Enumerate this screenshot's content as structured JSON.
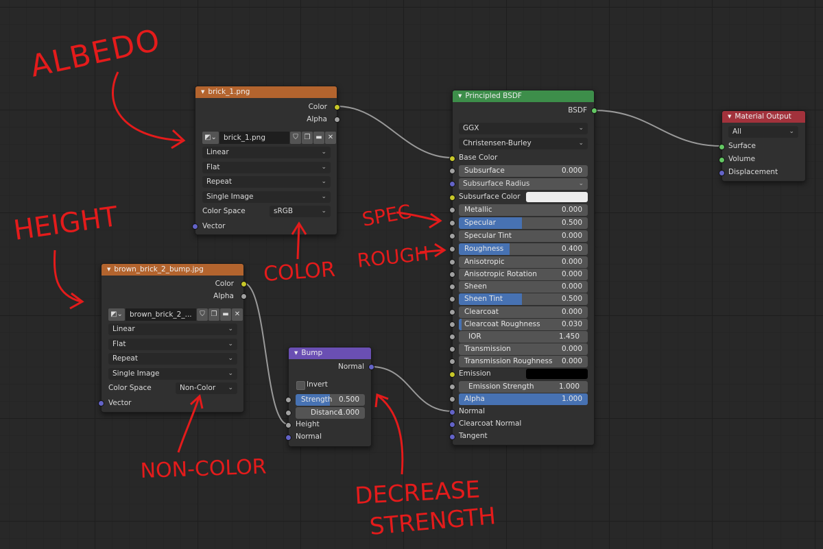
{
  "image_node_1": {
    "title": "brick_1.png",
    "outputs": [
      "Color",
      "Alpha"
    ],
    "image_name": "brick_1.png",
    "interpolation": "Linear",
    "projection": "Flat",
    "extension": "Repeat",
    "source": "Single Image",
    "color_space_label": "Color Space",
    "color_space": "sRGB",
    "input": "Vector"
  },
  "image_node_2": {
    "title": "brown_brick_2_bump.jpg",
    "outputs": [
      "Color",
      "Alpha"
    ],
    "image_name": "brown_brick_2_...",
    "interpolation": "Linear",
    "projection": "Flat",
    "extension": "Repeat",
    "source": "Single Image",
    "color_space_label": "Color Space",
    "color_space": "Non-Color",
    "input": "Vector"
  },
  "bump_node": {
    "title": "Bump",
    "output": "Normal",
    "invert_label": "Invert",
    "strength_label": "Strength",
    "strength_value": "0.500",
    "distance_label": "Distance",
    "distance_value": "1.000",
    "inputs": [
      "Height",
      "Normal"
    ]
  },
  "bsdf_node": {
    "title": "Principled BSDF",
    "output": "BSDF",
    "distribution": "GGX",
    "subsurface_method": "Christensen-Burley",
    "base_color_label": "Base Color",
    "subsurface_label": "Subsurface",
    "subsurface_value": "0.000",
    "subsurface_radius_label": "Subsurface Radius",
    "subsurface_color_label": "Subsurface Color",
    "metallic_label": "Metallic",
    "metallic_value": "0.000",
    "specular_label": "Specular",
    "specular_value": "0.500",
    "specular_tint_label": "Specular Tint",
    "specular_tint_value": "0.000",
    "roughness_label": "Roughness",
    "roughness_value": "0.400",
    "anisotropic_label": "Anisotropic",
    "anisotropic_value": "0.000",
    "anisotropic_rotation_label": "Anisotropic Rotation",
    "anisotropic_rotation_value": "0.000",
    "sheen_label": "Sheen",
    "sheen_value": "0.000",
    "sheen_tint_label": "Sheen Tint",
    "sheen_tint_value": "0.500",
    "clearcoat_label": "Clearcoat",
    "clearcoat_value": "0.000",
    "clearcoat_roughness_label": "Clearcoat Roughness",
    "clearcoat_roughness_value": "0.030",
    "ior_label": "IOR",
    "ior_value": "1.450",
    "transmission_label": "Transmission",
    "transmission_value": "0.000",
    "transmission_roughness_label": "Transmission Roughness",
    "transmission_roughness_value": "0.000",
    "emission_label": "Emission",
    "emission_strength_label": "Emission Strength",
    "emission_strength_value": "1.000",
    "alpha_label": "Alpha",
    "alpha_value": "1.000",
    "normal_label": "Normal",
    "clearcoat_normal_label": "Clearcoat Normal",
    "tangent_label": "Tangent"
  },
  "output_node": {
    "title": "Material Output",
    "target": "All",
    "inputs": [
      "Surface",
      "Volume",
      "Displacement"
    ]
  },
  "annotations": {
    "albedo": "ALBEDO",
    "height": "HEIGHT",
    "spec": "SPEC",
    "rough": "ROUGH",
    "color": "COLOR",
    "non_color": "NON-COLOR",
    "decrease": "DECREASE",
    "strength": "STRENGTH"
  },
  "colors": {
    "annotation_red": "#e41b1b",
    "image_header": "#b3642e",
    "bsdf_header": "#3d8e4a",
    "output_header": "#a2323c",
    "bump_header": "#6a4fb3",
    "slider_fill": "#4772b3"
  }
}
